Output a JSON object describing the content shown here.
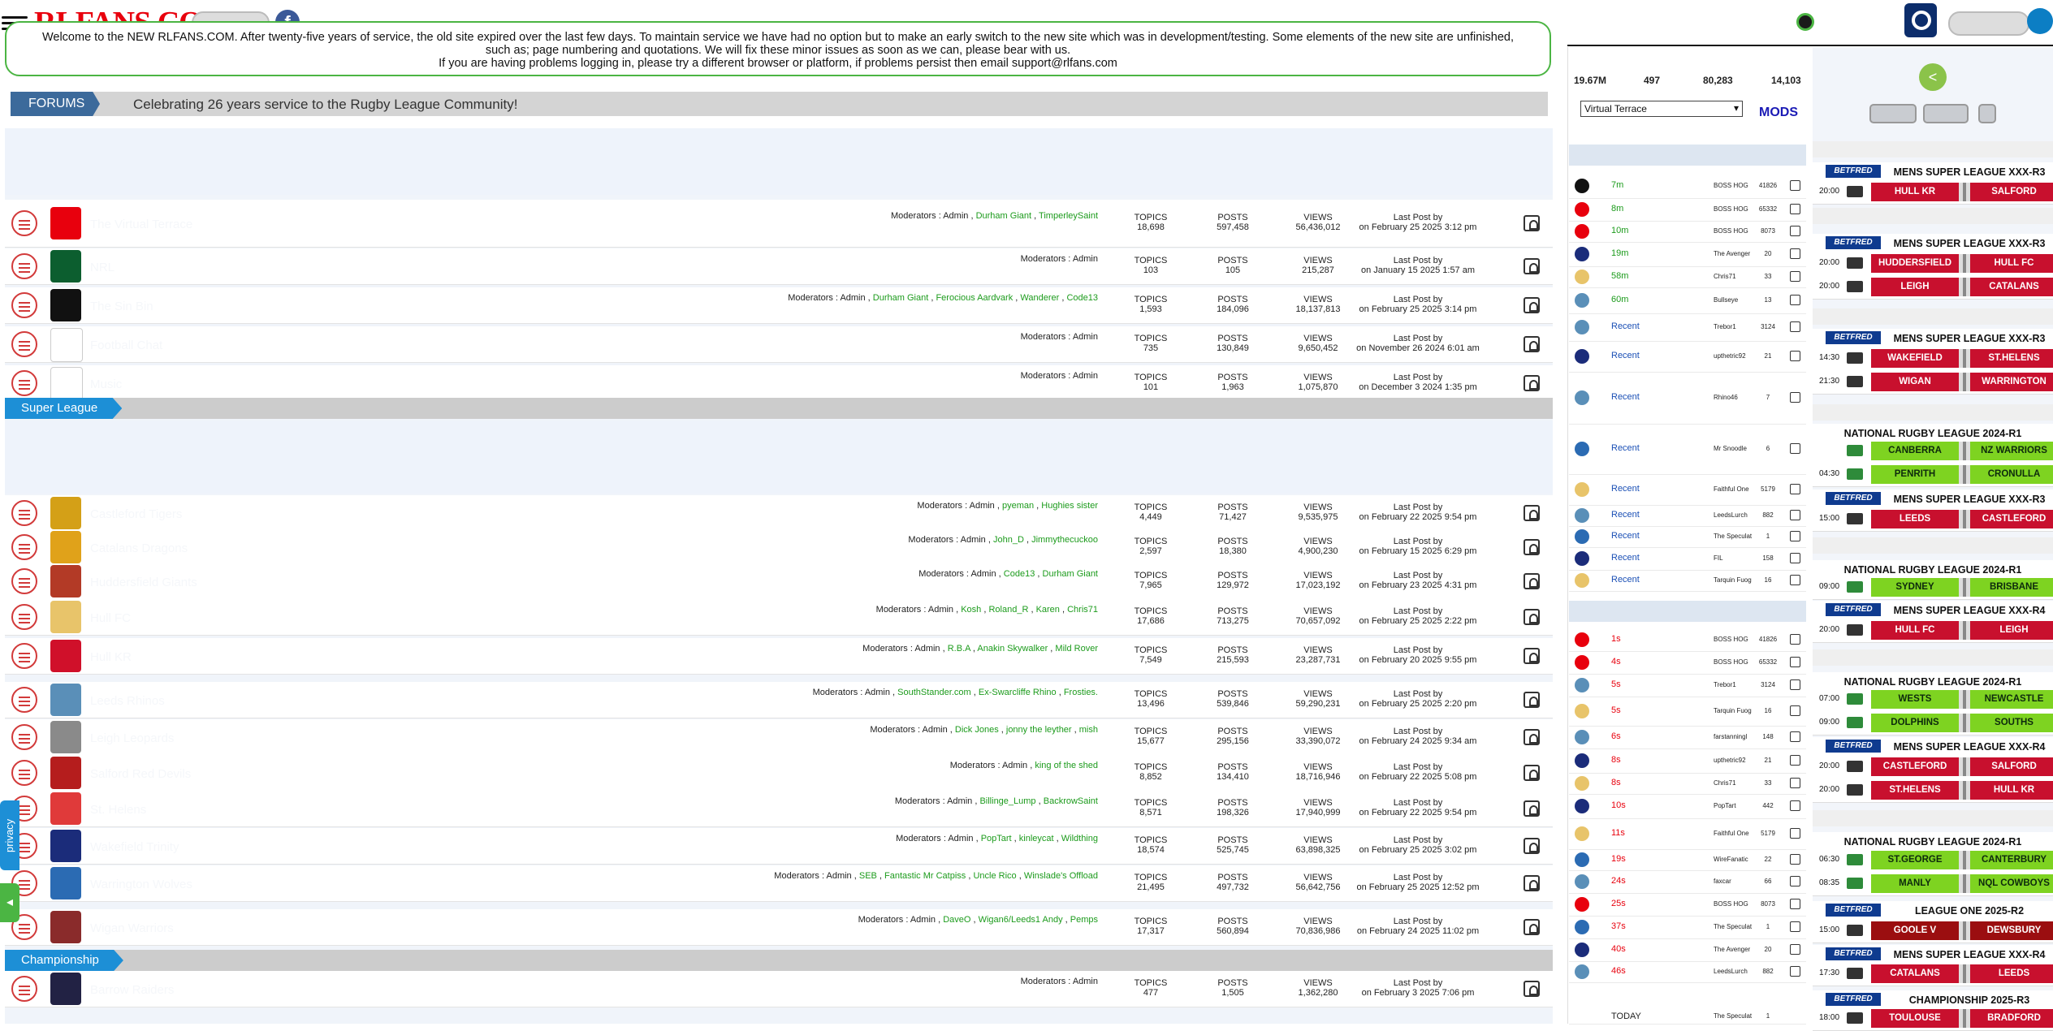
{
  "header": {
    "logo": "RLFANS.COM",
    "facebook_glyph": "f"
  },
  "welcome": {
    "line1": "Welcome to the NEW RLFANS.COM. After twenty-five years of service, the old site expired over the last few days. To maintain service we have had no option but to make an early switch to the new site which was in development/testing. Some elements of the new site are unfinished,",
    "line2": "such as; page numbering and quotations. We will fix these minor issues as soon as we can, please bear with us.",
    "line3": "If you are having problems logging in, please try a different browser or platform, if problems persist then email support@rlfans.com"
  },
  "forums": {
    "tab_label": "FORUMS",
    "slogan": "Celebrating 26 years service to the Rugby League Community!",
    "rows": [
      {
        "name": "The Virtual Terrace",
        "badge_color": "#e8000d",
        "mods": [
          "Durham Giant",
          "TimperleySaint"
        ],
        "topics": "18,698",
        "posts": "597,458",
        "views": "56,436,012",
        "last_by": "",
        "last_on": "on February 25 2025 3:12 pm"
      },
      {
        "name": "NRL",
        "badge_color": "#0c5e2f",
        "mods": [],
        "topics": "103",
        "posts": "105",
        "views": "215,287",
        "last_by": "",
        "last_on": "on January 15 2025 1:57 am"
      },
      {
        "name": "The Sin Bin",
        "badge_color": "#111111",
        "mods": [
          "Durham Giant",
          "Ferocious Aardvark",
          "Wanderer",
          "Code13"
        ],
        "topics": "1,593",
        "posts": "184,096",
        "views": "18,137,813",
        "last_by": "",
        "last_on": "on February 25 2025 3:14 pm"
      },
      {
        "name": "Football Chat",
        "badge_color": "#ffffff",
        "mods": [],
        "topics": "735",
        "posts": "130,849",
        "views": "9,650,452",
        "last_by": "",
        "last_on": "on November 26 2024 6:01 am"
      },
      {
        "name": "Music",
        "badge_color": "#ffffff",
        "mods": [],
        "topics": "101",
        "posts": "1,963",
        "views": "1,075,870",
        "last_by": "",
        "last_on": "on December 3 2024 1:35 pm"
      }
    ],
    "section_super_league": "Super League",
    "sl_rows": [
      {
        "name": "Castleford Tigers",
        "badge_color": "#d4a017",
        "mods": [
          "pyeman",
          "Hughies sister"
        ],
        "topics": "4,449",
        "posts": "71,427",
        "views": "9,535,975",
        "last_on": "on February 22 2025 9:54 pm"
      },
      {
        "name": "Catalans Dragons",
        "badge_color": "#e0a21a",
        "mods": [
          "John_D",
          "Jimmythecuckoo"
        ],
        "topics": "2,597",
        "posts": "18,380",
        "views": "4,900,230",
        "last_on": "on February 15 2025 6:29 pm"
      },
      {
        "name": "Huddersfield Giants",
        "badge_color": "#b33a26",
        "mods": [
          "Code13",
          "Durham Giant"
        ],
        "topics": "7,965",
        "posts": "129,972",
        "views": "17,023,192",
        "last_on": "on February 23 2025 4:31 pm"
      },
      {
        "name": "Hull FC",
        "badge_color": "#e8c46a",
        "mods": [
          "Kosh",
          "Roland_R",
          "Karen",
          "Chris71"
        ],
        "topics": "17,686",
        "posts": "713,275",
        "views": "70,657,092",
        "last_on": "on February 25 2025 2:22 pm"
      },
      {
        "name": "Hull KR",
        "badge_color": "#d0102a",
        "mods": [
          "R.B.A",
          "Anakin Skywalker",
          "Mild Rover"
        ],
        "topics": "7,549",
        "posts": "215,593",
        "views": "23,287,731",
        "last_on": "on February 20 2025 9:55 pm"
      },
      {
        "name": "Leeds Rhinos",
        "badge_color": "#5a8fb8",
        "mods": [
          "SouthStander.com",
          "Ex-Swarcliffe Rhino",
          "Frosties."
        ],
        "topics": "13,496",
        "posts": "539,846",
        "views": "59,290,231",
        "last_on": "on February 25 2025 2:20 pm"
      },
      {
        "name": "Leigh Leopards",
        "badge_color": "#8a8a8a",
        "mods": [
          "Dick Jones",
          "jonny the leyther",
          "mish"
        ],
        "topics": "15,677",
        "posts": "295,156",
        "views": "33,390,072",
        "last_on": "on February 24 2025 9:34 am"
      },
      {
        "name": "Salford Red Devils",
        "badge_color": "#b51d1d",
        "mods": [
          "king of the shed"
        ],
        "topics": "8,852",
        "posts": "134,410",
        "views": "18,716,946",
        "last_on": "on February 22 2025 5:08 pm"
      },
      {
        "name": "St. Helens",
        "badge_color": "#e03a3a",
        "mods": [
          "Billinge_Lump",
          "BackrowSaint"
        ],
        "topics": "8,571",
        "posts": "198,326",
        "views": "17,940,999",
        "last_on": "on February 22 2025 9:54 pm"
      },
      {
        "name": "Wakefield Trinity",
        "badge_color": "#1b2c7a",
        "mods": [
          "PopTart",
          "kinleycat",
          "Wildthing"
        ],
        "topics": "18,574",
        "posts": "525,745",
        "views": "63,898,325",
        "last_on": "on February 25 2025 3:02 pm"
      },
      {
        "name": "Warrington Wolves",
        "badge_color": "#2b6bb3",
        "mods": [
          "SEB",
          "Fantastic Mr Catpiss",
          "Uncle Rico",
          "Winslade's Offload"
        ],
        "topics": "21,495",
        "posts": "497,732",
        "views": "56,642,756",
        "last_on": "on February 25 2025 12:52 pm"
      },
      {
        "name": "Wigan Warriors",
        "badge_color": "#8a2b2b",
        "mods": [
          "DaveO",
          "Wigan6/Leeds1 Andy",
          "Pemps"
        ],
        "topics": "17,317",
        "posts": "560,894",
        "views": "70,836,986",
        "last_on": "on February 24 2025 11:02 pm"
      }
    ],
    "section_championship": "Championship",
    "ch_rows": [
      {
        "name": "Barrow Raiders",
        "badge_color": "#222244",
        "mods": [],
        "topics": "477",
        "posts": "1,505",
        "views": "1,362,280",
        "last_on": "on February 3 2025 7:06 pm"
      }
    ],
    "labels": {
      "moderators": "Moderators : ",
      "admin": "Admin",
      "topics": "TOPICS",
      "posts": "POSTS",
      "views": "VIEWS",
      "last_post_by": "Last Post by"
    }
  },
  "stats": {
    "a": "19.67M",
    "b": "497",
    "c": "80,283",
    "d": "14,103"
  },
  "virtual_terrace_select": "Virtual Terrace",
  "mods_link": "MODS",
  "recent_threads": [
    {
      "time": "7m",
      "author": "BOSS HOG",
      "num": "41826",
      "color": "#111111"
    },
    {
      "time": "8m",
      "author": "BOSS HOG",
      "num": "65332",
      "color": "#e8000d"
    },
    {
      "time": "10m",
      "author": "BOSS HOG",
      "num": "8073",
      "color": "#e8000d"
    },
    {
      "time": "19m",
      "author": "The Avenger",
      "num": "20",
      "color": "#1b2c7a"
    },
    {
      "time": "58m",
      "author": "Chris71",
      "num": "33",
      "color": "#e8c46a"
    },
    {
      "time": "60m",
      "author": "Bullseye",
      "num": "13",
      "color": "#5a8fb8"
    },
    {
      "time": "Recent",
      "author": "Trebor1",
      "num": "3124",
      "color": "#5a8fb8"
    },
    {
      "time": "Recent",
      "author": "upthetric92",
      "num": "21",
      "color": "#1b2c7a"
    },
    {
      "time": "Recent",
      "author": "Rhino46",
      "num": "7",
      "color": "#5a8fb8"
    },
    {
      "time": "Recent",
      "author": "Mr Snoodle",
      "num": "6",
      "color": "#2b6bb3"
    },
    {
      "time": "Recent",
      "author": "Faithful One",
      "num": "5179",
      "color": "#e8c46a"
    },
    {
      "time": "Recent",
      "author": "LeedsLurch",
      "num": "882",
      "color": "#5a8fb8"
    },
    {
      "time": "Recent",
      "author": "The Speculat",
      "num": "1",
      "color": "#2b6bb3"
    },
    {
      "time": "Recent",
      "author": "FIL",
      "num": "158",
      "color": "#1b2c7a"
    },
    {
      "time": "Recent",
      "author": "Tarquin Fuog",
      "num": "16",
      "color": "#e8c46a"
    }
  ],
  "recent_posts": [
    {
      "time": "1s",
      "author": "BOSS HOG",
      "num": "41826",
      "color": "#e8000d"
    },
    {
      "time": "4s",
      "author": "BOSS HOG",
      "num": "65332",
      "color": "#e8000d"
    },
    {
      "time": "5s",
      "author": "Trebor1",
      "num": "3124",
      "color": "#5a8fb8"
    },
    {
      "time": "5s",
      "author": "Tarquin Fuog",
      "num": "16",
      "color": "#e8c46a"
    },
    {
      "time": "6s",
      "author": "farstanningl",
      "num": "148",
      "color": "#5a8fb8"
    },
    {
      "time": "8s",
      "author": "upthetric92",
      "num": "21",
      "color": "#1b2c7a"
    },
    {
      "time": "8s",
      "author": "Chris71",
      "num": "33",
      "color": "#e8c46a"
    },
    {
      "time": "10s",
      "author": "PopTart",
      "num": "442",
      "color": "#1b2c7a"
    },
    {
      "time": "11s",
      "author": "Faithful One",
      "num": "5179",
      "color": "#e8c46a"
    },
    {
      "time": "19s",
      "author": "WireFanatic",
      "num": "22",
      "color": "#2b6bb3"
    },
    {
      "time": "24s",
      "author": "faxcar",
      "num": "66",
      "color": "#5a8fb8"
    },
    {
      "time": "25s",
      "author": "BOSS HOG",
      "num": "8073",
      "color": "#e8000d"
    },
    {
      "time": "37s",
      "author": "The Speculat",
      "num": "1",
      "color": "#2b6bb3"
    },
    {
      "time": "40s",
      "author": "The Avenger",
      "num": "20",
      "color": "#1b2c7a"
    },
    {
      "time": "46s",
      "author": "LeedsLurch",
      "num": "882",
      "color": "#5a8fb8"
    }
  ],
  "today_row": {
    "time": "TODAY",
    "author": "The Speculat",
    "num": "1"
  },
  "fixtures": {
    "competitions": {
      "sl3": "MENS SUPER LEAGUE XXX-R3",
      "sl4": "MENS SUPER LEAGUE XXX-R4",
      "nrl": "NATIONAL RUGBY LEAGUE 2024-R1",
      "l1": "LEAGUE ONE 2025-R2",
      "ch": "CHAMPIONSHIP 2025-R3"
    },
    "sponsor": "BETFRED",
    "matches": [
      {
        "time": "20:00",
        "home": "HULL KR",
        "away": "SALFORD",
        "type": "sl"
      },
      {
        "time": "20:00",
        "home": "HUDDERSFIELD",
        "away": "HULL FC",
        "type": "sl"
      },
      {
        "time": "20:00",
        "home": "LEIGH",
        "away": "CATALANS",
        "type": "sl"
      },
      {
        "time": "14:30",
        "home": "WAKEFIELD",
        "away": "ST.HELENS",
        "type": "sl"
      },
      {
        "time": "21:30",
        "home": "WIGAN",
        "away": "WARRINGTON",
        "type": "sl"
      },
      {
        "time": "",
        "home": "CANBERRA",
        "away": "NZ WARRIORS",
        "type": "nrl"
      },
      {
        "time": "04:30",
        "home": "PENRITH",
        "away": "CRONULLA",
        "type": "nrl"
      },
      {
        "time": "15:00",
        "home": "LEEDS",
        "away": "CASTLEFORD",
        "type": "sl"
      },
      {
        "time": "09:00",
        "home": "SYDNEY",
        "away": "BRISBANE",
        "type": "nrl"
      },
      {
        "time": "20:00",
        "home": "HULL FC",
        "away": "LEIGH",
        "type": "sl"
      },
      {
        "time": "07:00",
        "home": "WESTS",
        "away": "NEWCASTLE",
        "type": "nrl"
      },
      {
        "time": "09:00",
        "home": "DOLPHINS",
        "away": "SOUTHS",
        "type": "nrl"
      },
      {
        "time": "20:00",
        "home": "CASTLEFORD",
        "away": "SALFORD",
        "type": "sl"
      },
      {
        "time": "20:00",
        "home": "ST.HELENS",
        "away": "HULL KR",
        "type": "sl"
      },
      {
        "time": "06:30",
        "home": "ST.GEORGE",
        "away": "CANTERBURY",
        "type": "nrl"
      },
      {
        "time": "08:35",
        "home": "MANLY",
        "away": "NQL COWBOYS",
        "type": "nrl"
      },
      {
        "time": "15:00",
        "home": "GOOLE V",
        "away": "DEWSBURY",
        "type": "l1"
      },
      {
        "time": "17:30",
        "home": "CATALANS",
        "away": "LEEDS",
        "type": "sl"
      },
      {
        "time": "18:00",
        "home": "TOULOUSE",
        "away": "BRADFORD",
        "type": "sl"
      }
    ]
  },
  "privacy_label": "privacy",
  "colors": {
    "accent_blue": "#1d8fd6",
    "forum_blue": "#3c6a9b",
    "green": "#4bb543",
    "red": "#e8000d"
  }
}
